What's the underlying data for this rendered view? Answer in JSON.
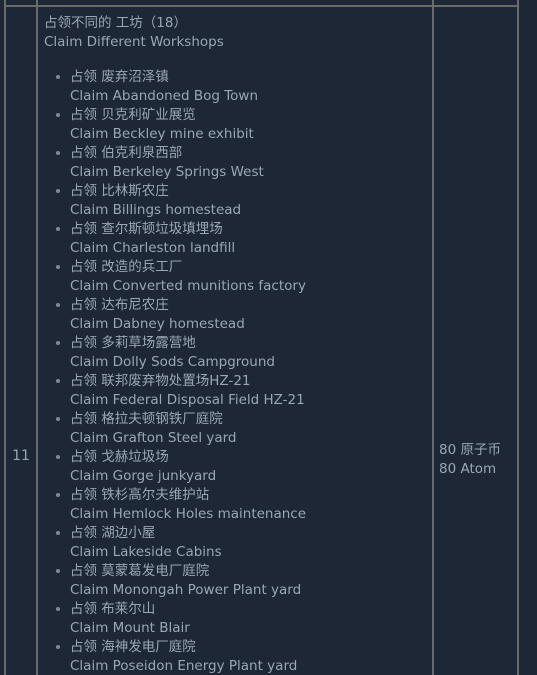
{
  "table": {
    "row_index": "11",
    "title": {
      "cn": "占领不同的 工坊（18）",
      "en": "Claim Different Workshops"
    },
    "objectives": [
      {
        "cn": "占领 废弃沼泽镇",
        "en": "Claim Abandoned Bog Town"
      },
      {
        "cn": "占领 贝克利矿业展览",
        "en": "Claim Beckley mine exhibit"
      },
      {
        "cn": "占领 伯克利泉西部",
        "en": "Claim Berkeley Springs West"
      },
      {
        "cn": "占领 比林斯农庄",
        "en": "Claim Billings homestead"
      },
      {
        "cn": "占领 查尔斯顿垃圾填埋场",
        "en": "Claim Charleston landfill"
      },
      {
        "cn": "占领 改造的兵工厂",
        "en": "Claim Converted munitions factory"
      },
      {
        "cn": "占领 达布尼农庄",
        "en": "Claim Dabney homestead"
      },
      {
        "cn": "占领 多莉草场露营地",
        "en": "Claim Dolly Sods Campground"
      },
      {
        "cn": "占领 联邦废弃物处置场HZ-21",
        "en": "Claim Federal Disposal Field HZ-21"
      },
      {
        "cn": "占领 格拉夫顿钢铁厂庭院",
        "en": "Claim Grafton Steel yard"
      },
      {
        "cn": "占领 戈赫垃圾场",
        "en": "Claim Gorge junkyard"
      },
      {
        "cn": "占领 铁杉高尔夫维护站",
        "en": "Claim Hemlock Holes maintenance"
      },
      {
        "cn": "占领 湖边小屋",
        "en": "Claim Lakeside Cabins"
      },
      {
        "cn": "占领 莫蒙葛发电厂庭院",
        "en": "Claim Monongah Power Plant yard"
      },
      {
        "cn": "占领 布莱尔山",
        "en": "Claim Mount Blair"
      },
      {
        "cn": "占领 海神发电厂庭院",
        "en": "Claim Poseidon Energy Plant yard"
      }
    ],
    "reward": {
      "cn": "80 原子币",
      "en": "80 Atom"
    }
  },
  "colors": {
    "background": "#1d2735",
    "border": "#6a6a6a",
    "text": "#9aa7b4"
  }
}
